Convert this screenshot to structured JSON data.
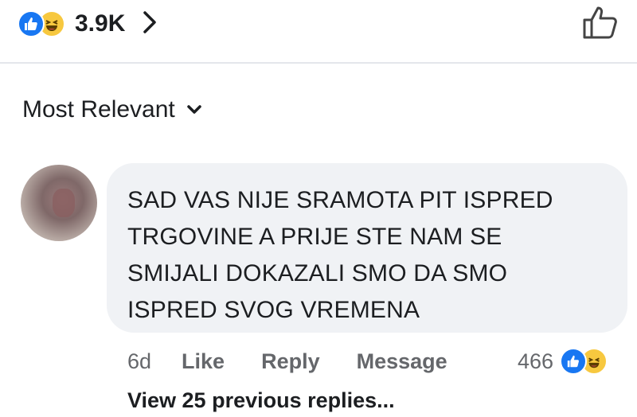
{
  "header": {
    "reaction_count": "3.9K",
    "reaction_icons": [
      "like-icon",
      "haha-icon"
    ],
    "like_button_icon": "thumbs-up-outline-icon"
  },
  "sort": {
    "label": "Most Relevant",
    "icon": "chevron-down-icon"
  },
  "comment": {
    "lines": [
      "SAD VAS NIJE SRAMOTA PIT ISPRED",
      "TRGOVINE A PRIJE STE NAM SE",
      "SMIJALI DOKAZALI SMO DA SMO",
      "ISPRED SVOG VREMENA"
    ],
    "age": "6d",
    "actions": {
      "like": "Like",
      "reply": "Reply",
      "message": "Message"
    },
    "reaction_count": "466"
  },
  "replies": {
    "view_previous": "View 25 previous replies..."
  },
  "colors": {
    "like_blue": "#1877f2",
    "haha_yellow": "#f7c83f",
    "bubble_bg": "#f0f2f5",
    "secondary_text": "#65676b"
  }
}
